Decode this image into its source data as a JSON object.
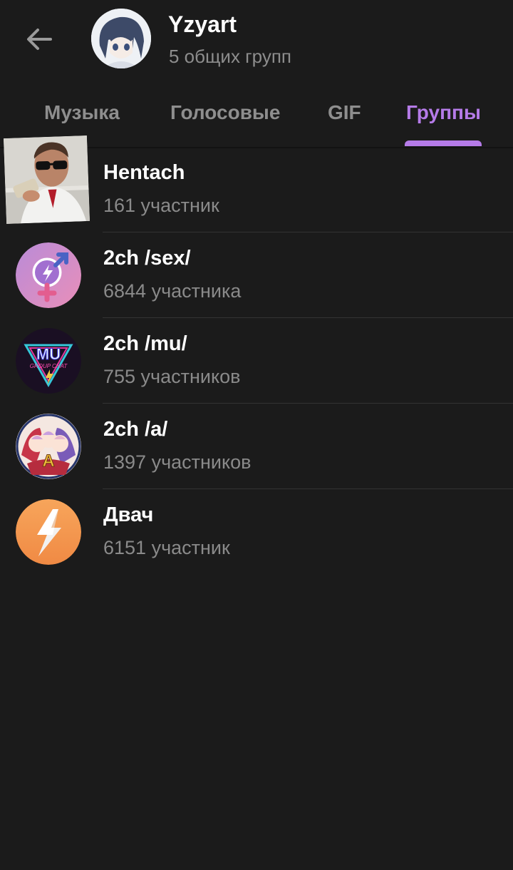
{
  "header": {
    "title": "Yzyart",
    "subtitle": "5 общих групп",
    "back_icon": "arrow-left-icon"
  },
  "tabs": [
    {
      "label": "Музыка",
      "active": false
    },
    {
      "label": "Голосовые",
      "active": false
    },
    {
      "label": "GIF",
      "active": false
    },
    {
      "label": "Группы",
      "active": true
    }
  ],
  "groups": [
    {
      "name": "Hentach",
      "members": "161 участник"
    },
    {
      "name": "2ch /sex/",
      "members": "6844 участника"
    },
    {
      "name": "2ch /mu/",
      "members": "755 участников"
    },
    {
      "name": "2ch /a/",
      "members": "1397 участников"
    },
    {
      "name": "Двач",
      "members": "6151 участник"
    }
  ],
  "colors": {
    "background": "#1b1b1b",
    "accent": "#b57be8",
    "secondary_text": "#8a8a8a"
  },
  "avatars": {
    "2ch_mu_logo": "MU",
    "2ch_mu_logo_sub": "GROUP CHAT",
    "2ch_a_logo": "A"
  }
}
